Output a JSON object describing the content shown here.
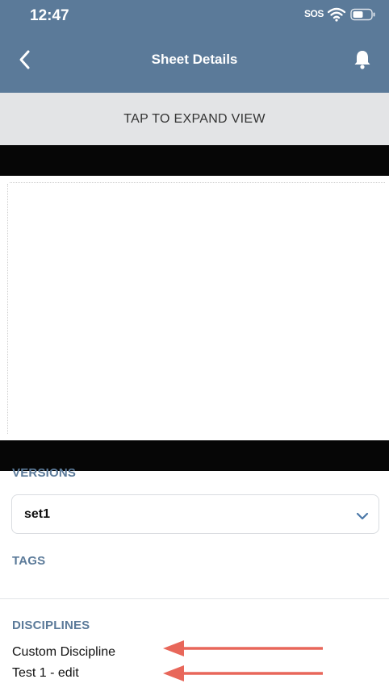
{
  "status_bar": {
    "time": "12:47",
    "sos": "SOS",
    "wifi_icon": "wifi-icon",
    "battery_icon": "battery-icon"
  },
  "header": {
    "title": "Sheet Details",
    "back_icon": "chevron-left-icon",
    "bell_icon": "bell-icon",
    "background_color": "#5b7a99"
  },
  "expand_button": {
    "label": "TAP TO EXPAND VIEW"
  },
  "versions": {
    "label": "VERSIONS",
    "selected": "set1",
    "chevron_icon": "chevron-down-icon"
  },
  "tags": {
    "label": "TAGS"
  },
  "disciplines": {
    "label": "DISCIPLINES",
    "items": [
      "Custom Discipline",
      "Test 1 - edit"
    ]
  },
  "annotation": {
    "arrow_color": "#e8675a"
  }
}
